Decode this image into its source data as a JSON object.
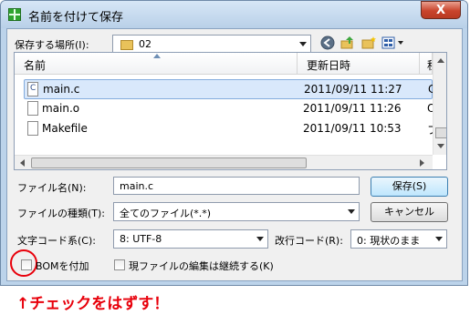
{
  "window": {
    "title": "名前を付けて保存",
    "close_label": "X"
  },
  "location": {
    "label": "保存する場所(I):",
    "folder": "02"
  },
  "columns": [
    "名前",
    "更新日時",
    "種"
  ],
  "files": [
    {
      "name": "main.c",
      "date": "2011/09/11 11:27",
      "type": "C",
      "icon": "c-source-file-icon",
      "selected": true
    },
    {
      "name": "main.o",
      "date": "2011/09/11 11:26",
      "type": "O",
      "icon": "file-icon",
      "selected": false
    },
    {
      "name": "Makefile",
      "date": "2011/09/11 10:53",
      "type": "フ",
      "icon": "file-icon",
      "selected": false
    }
  ],
  "form": {
    "filename_label": "ファイル名(N):",
    "filename_value": "main.c",
    "filetype_label": "ファイルの種類(T):",
    "filetype_value": "全てのファイル(*.*)",
    "encoding_label": "文字コード系(C):",
    "encoding_value": "8: UTF-8",
    "newline_label": "改行コード(R):",
    "newline_value": "0: 現状のまま",
    "bom_label": "BOMを付加",
    "continue_edit_label": "現ファイルの編集は継続する(K)"
  },
  "buttons": {
    "save": "保存(S)",
    "cancel": "キャンセル"
  },
  "annotation": "↑チェックをはずす！",
  "colors": {
    "annotation": "#e8000b",
    "title_bg": "#c6dbf1",
    "selection": "#d9e8fb"
  }
}
